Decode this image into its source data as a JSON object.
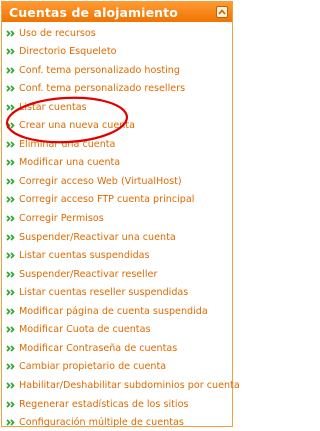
{
  "panel": {
    "title": "Cuentas de alojamiento",
    "accent_color": "#f07400",
    "link_color": "#e06a00",
    "bullet_color": "#2fa82f",
    "collapse_icon": "chevron-up-icon"
  },
  "menu": {
    "items": [
      {
        "label": "Uso de recursos"
      },
      {
        "label": "Directorio Esqueleto"
      },
      {
        "label": "Conf. tema personalizado hosting"
      },
      {
        "label": "Conf. tema personalizado resellers"
      },
      {
        "label": "Listar cuentas"
      },
      {
        "label": "Crear una nueva cuenta"
      },
      {
        "label": "Eliminar una cuenta"
      },
      {
        "label": "Modificar una cuenta"
      },
      {
        "label": "Corregir acceso Web (VirtualHost)"
      },
      {
        "label": "Corregir acceso FTP cuenta principal"
      },
      {
        "label": "Corregir Permisos"
      },
      {
        "label": "Suspender/Reactivar una cuenta"
      },
      {
        "label": "Listar cuentas suspendidas"
      },
      {
        "label": "Suspender/Reactivar reseller"
      },
      {
        "label": "Listar cuentas reseller suspendidas"
      },
      {
        "label": "Modificar página de cuenta suspendida"
      },
      {
        "label": "Modificar Cuota de cuentas"
      },
      {
        "label": "Modificar Contraseña de cuentas"
      },
      {
        "label": "Cambiar propietario de cuenta"
      },
      {
        "label": "Habilitar/Deshabilitar subdominios por cuenta"
      },
      {
        "label": "Regenerar estadísticas de los sitios"
      },
      {
        "label": "Configuración múltiple de cuentas"
      }
    ]
  },
  "annotation": {
    "type": "red-oval-highlight",
    "highlighted_item": "Crear una nueva cuenta",
    "color": "#e00000"
  }
}
